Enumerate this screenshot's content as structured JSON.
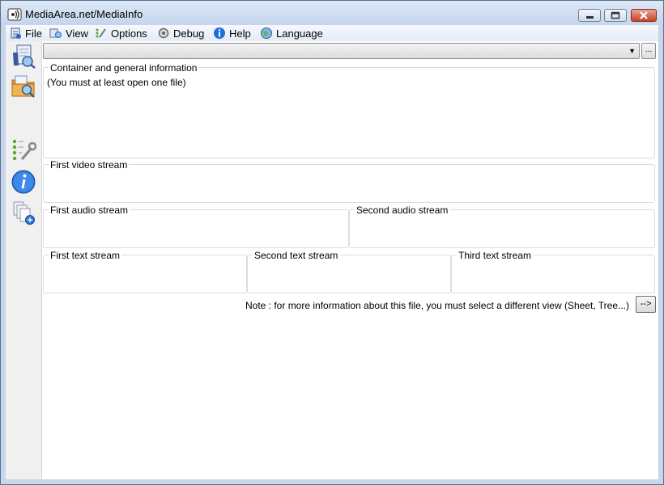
{
  "window": {
    "title": "MediaArea.net/MediaInfo"
  },
  "menu": {
    "items": [
      {
        "label": "File",
        "icon": "file-open-icon"
      },
      {
        "label": "View",
        "icon": "view-icon"
      },
      {
        "label": "Options",
        "icon": "options-icon"
      },
      {
        "label": "Debug",
        "icon": "debug-icon"
      },
      {
        "label": "Help",
        "icon": "help-icon"
      },
      {
        "label": "Language",
        "icon": "language-globe-icon"
      }
    ]
  },
  "toolbar": {
    "icons": [
      "open-file-icon",
      "open-folder-icon",
      "preferences-icon",
      "about-info-icon",
      "export-icon"
    ]
  },
  "file_combo": {
    "value": "",
    "browse_label": "..."
  },
  "groups": {
    "general": {
      "label": "Container and general information",
      "content": "(You must at least open one file)"
    },
    "video1": {
      "label": "First video stream"
    },
    "audio1": {
      "label": "First audio stream"
    },
    "audio2": {
      "label": "Second audio stream"
    },
    "text1": {
      "label": "First text stream"
    },
    "text2": {
      "label": "Second text stream"
    },
    "text3": {
      "label": "Third text stream"
    }
  },
  "note": {
    "text": "Note : for more information about this file, you must select a different view (Sheet, Tree...)",
    "button_label": "-->"
  },
  "colors": {
    "window_frame": "#c7d6ea",
    "close_button": "#c7422a",
    "group_border": "#d7dde6"
  }
}
